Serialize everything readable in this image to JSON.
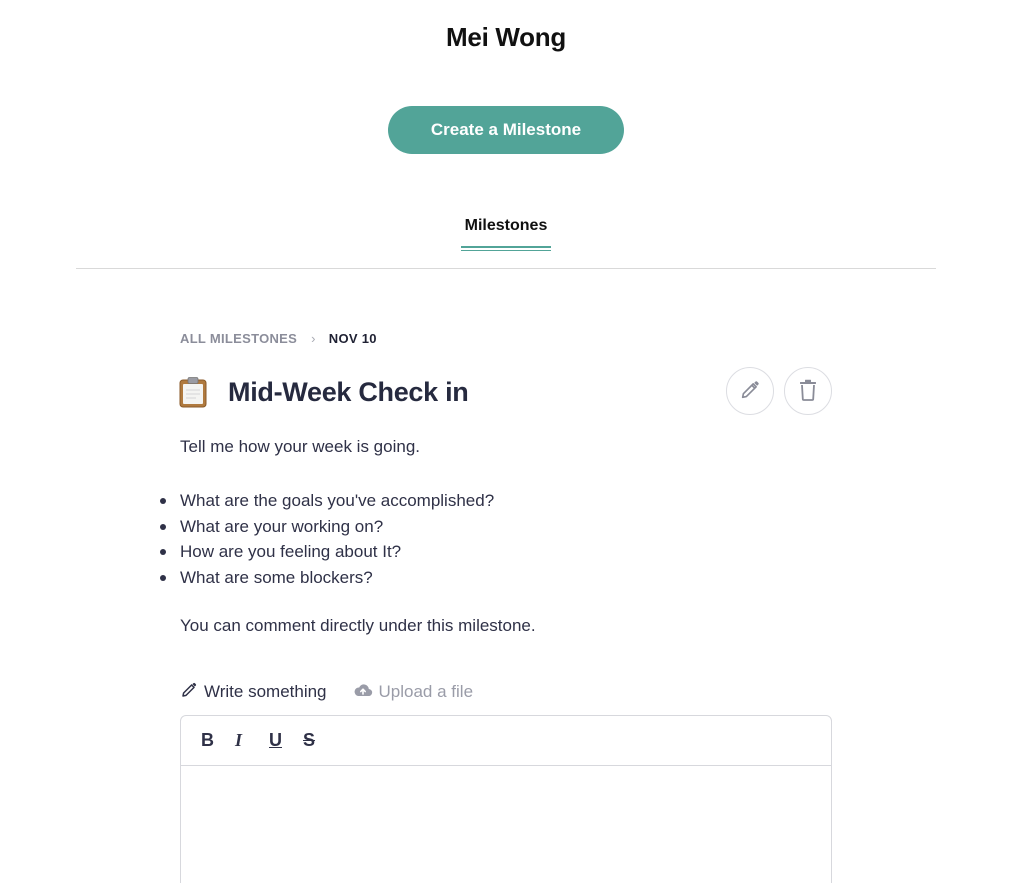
{
  "header": {
    "profile_name": "Mei Wong",
    "create_button_label": "Create a Milestone"
  },
  "tabs": [
    {
      "label": "Milestones",
      "active": true
    }
  ],
  "breadcrumb": {
    "root": "ALL MILESTONES",
    "separator": "›",
    "current": "NOV 10"
  },
  "milestone": {
    "icon": "clipboard-icon",
    "title": "Mid-Week Check in",
    "intro": "Tell me how your week is going.",
    "questions": [
      "What are the goals you've accomplished?",
      "What are your working on?",
      "How are you feeling about It?",
      "What are some blockers?"
    ],
    "outro": "You can comment directly under this milestone."
  },
  "actions": {
    "edit_icon": "pencil-icon",
    "delete_icon": "trash-icon"
  },
  "comment": {
    "write_tab_label": "Write something",
    "upload_tab_label": "Upload a file",
    "toolbar": {
      "bold": "B",
      "italic": "I",
      "underline": "U",
      "strike": "S"
    },
    "body_value": ""
  },
  "colors": {
    "accent": "#52a498",
    "text_primary": "#2f3147",
    "text_muted": "#9a9ca8",
    "border": "#d7d8dd"
  }
}
